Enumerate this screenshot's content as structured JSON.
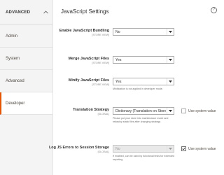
{
  "sidebar": {
    "title": "ADVANCED",
    "items": [
      {
        "label": "Admin"
      },
      {
        "label": "System"
      },
      {
        "label": "Advanced"
      },
      {
        "label": "Developer"
      }
    ]
  },
  "main": {
    "title": "JavaScript Settings",
    "help_icon": "?",
    "fields": [
      {
        "label": "Enable JavaScript Bundling",
        "scope": "[STORE VIEW]",
        "value": "No"
      },
      {
        "label": "Merge JavaScript Files",
        "scope": "[STORE VIEW]",
        "value": "Yes"
      },
      {
        "label": "Minify JavaScript Files",
        "scope": "[STORE VIEW]",
        "value": "Yes",
        "note": "Minification is not applied in developer mode."
      },
      {
        "label": "Translation Strategy",
        "scope": "[GLOBAL]",
        "value": "Dictionary (Translation on Storefront side)",
        "note": "Please put your store into maintenance mode and redeploy static files after changing strategy",
        "checkbox_label": "Use system value",
        "checkbox_checked": false
      },
      {
        "label": "Log JS Errors to Session Storage",
        "scope": "[GLOBAL]",
        "value": "No",
        "note": "If enabled, can be used by functional tests for extended reporting",
        "checkbox_label": "Use system value",
        "checkbox_checked": true
      }
    ]
  },
  "colors": {
    "accent": "#eb5202",
    "sidebar_bg": "#f4f4f4"
  }
}
